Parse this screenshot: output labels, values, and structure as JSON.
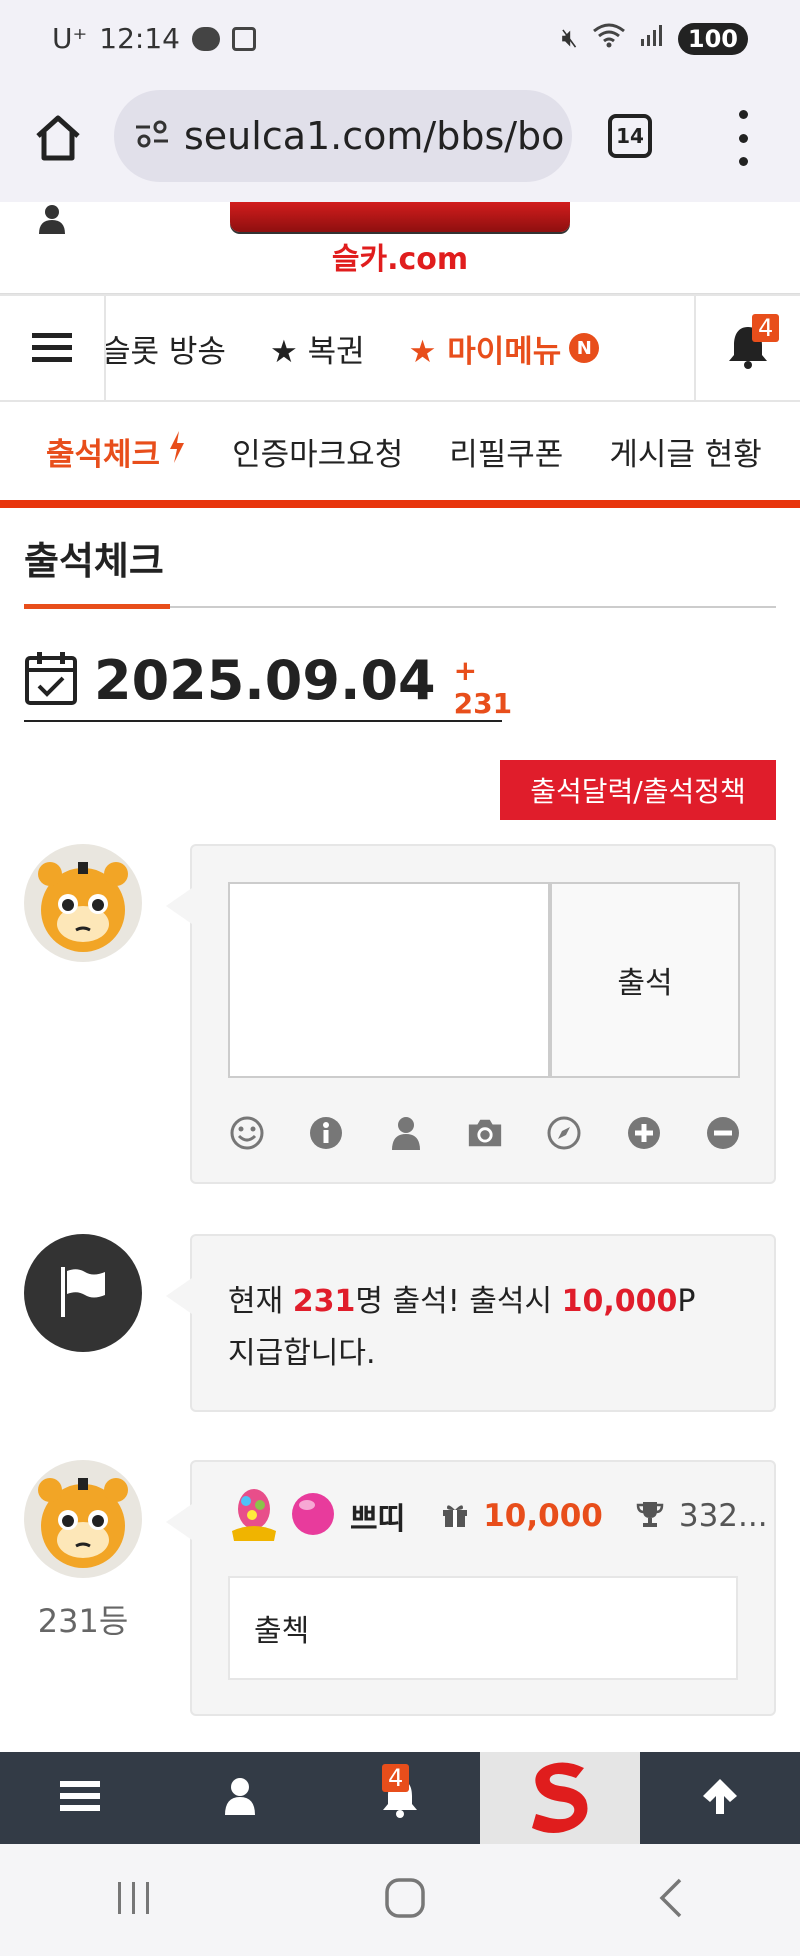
{
  "status_bar": {
    "carrier": "U⁺",
    "time": "12:14",
    "battery": "100"
  },
  "browser": {
    "url": "seulca1.com/bbs/bo",
    "tab_count": "14"
  },
  "site": {
    "logo_sub": "슬카.com"
  },
  "nav": {
    "items": [
      "슬롯 방송",
      "★ 복권",
      "★ 마이메뉴"
    ],
    "mymenu_badge": "N",
    "bell_count": "4"
  },
  "subnav": {
    "items": [
      "출석체크",
      "인증마크요청",
      "리필쿠폰",
      "게시글 현황"
    ]
  },
  "page": {
    "title": "출석체크",
    "date": "2025.09.04",
    "date_count": "+ 231",
    "calendar_button": "출석달력/출석정책"
  },
  "form": {
    "submit_label": "출석",
    "textarea_value": ""
  },
  "notice": {
    "prefix": "현재 ",
    "count": "231",
    "middle": "명 출석! 출석시 ",
    "points": "10,000",
    "suffix": "P 지급합니다."
  },
  "comment": {
    "rank": "231등",
    "nickname": "쁘띠",
    "points": "10,000",
    "trophy": "332...",
    "text": "출첵"
  },
  "bottom_bar": {
    "bell_count": "4"
  },
  "colors": {
    "accent": "#e84e1b",
    "red": "#e01d2b",
    "bottom_bar": "#333b46"
  }
}
